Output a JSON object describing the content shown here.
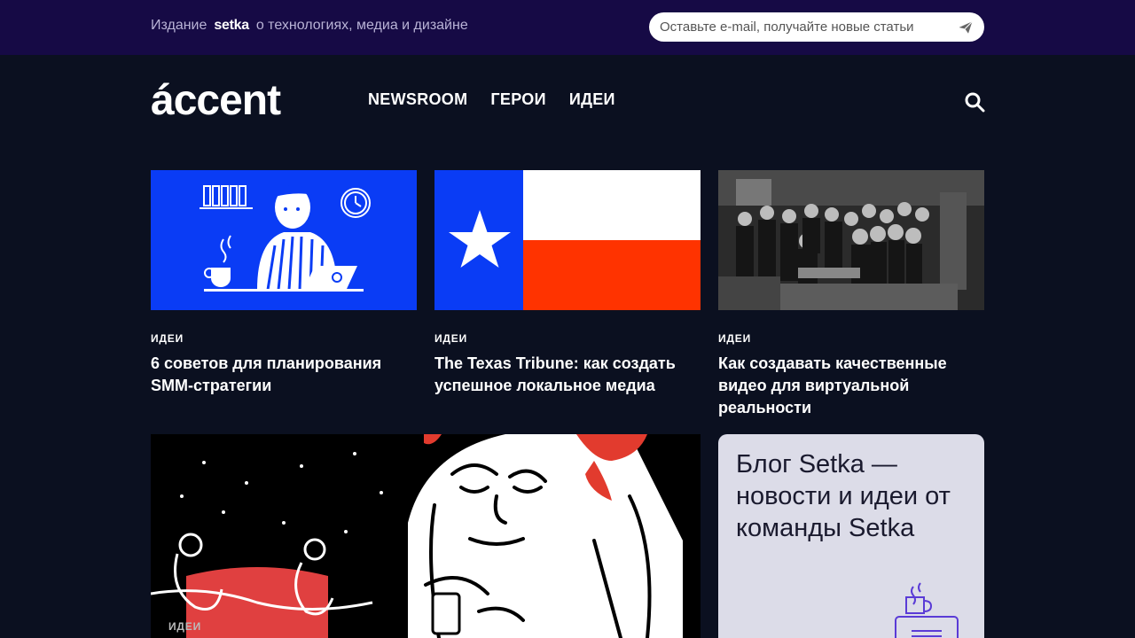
{
  "topbar": {
    "prefix": "Издание",
    "brand": "setka",
    "suffix": "о технологиях, медиа и дизайне",
    "subscribe_placeholder": "Оставьте e-mail, получайте новые статьи"
  },
  "header": {
    "logo": "áccent",
    "nav": [
      "NEWSROOM",
      "ГЕРОИ",
      "ИДЕИ"
    ]
  },
  "cards": [
    {
      "category": "ИДЕИ",
      "title": "6 советов для планирования SMM-стратегии"
    },
    {
      "category": "ИДЕИ",
      "title": "The Texas Tribune: как создать успешное локальное медиа"
    },
    {
      "category": "ИДЕИ",
      "title": "Как создавать качественные видео для виртуальной реальности"
    }
  ],
  "feature": {
    "category": "ИДЕИ"
  },
  "blog": {
    "text": "Блог Setka — новости и идеи от команды Setka"
  },
  "colors": {
    "topbar_bg": "#160a45",
    "page_bg": "#0b1020",
    "blue_card": "#0a3cf5",
    "flag_blue": "#0a3cf5",
    "flag_red": "#ff3300"
  },
  "icons": {
    "subscribe": "send-icon",
    "search": "search-icon"
  }
}
